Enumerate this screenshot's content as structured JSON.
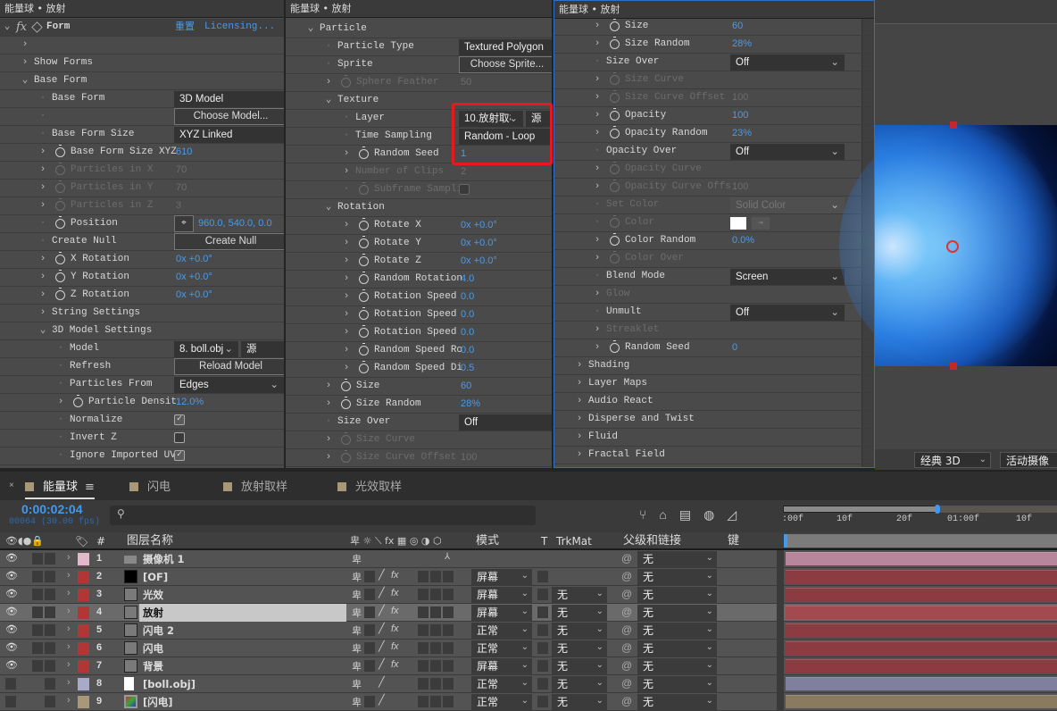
{
  "panel_title": "能量球 • 放射",
  "colors": {
    "accent_blue": "#4a9ae8",
    "highlight_red": "#e8191c",
    "panel_border_blue": "#2f6fd0"
  },
  "effects": {
    "left": {
      "effect_name": "Form",
      "reset": "重置",
      "licensing": "Licensing...",
      "rows": [
        {
          "lvl": 0,
          "tw": "open",
          "label": "Form",
          "special": "header"
        },
        {
          "lvl": 1,
          "tw": "closed",
          "label": ""
        },
        {
          "lvl": 1,
          "tw": "closed",
          "label": "Show Forms"
        },
        {
          "lvl": 1,
          "tw": "open",
          "label": "Base Form"
        },
        {
          "lvl": 2,
          "tw": "none",
          "label": "Base Form",
          "type": "dd",
          "value": "3D Model"
        },
        {
          "lvl": 2,
          "tw": "none",
          "label": "",
          "type": "btn",
          "value": "Choose Model..."
        },
        {
          "lvl": 2,
          "tw": "none",
          "label": "Base Form Size",
          "type": "dd",
          "value": "XYZ Linked"
        },
        {
          "lvl": 2,
          "tw": "closed",
          "sw": true,
          "label": "Base Form Size XYZ",
          "type": "num",
          "value": "610"
        },
        {
          "lvl": 2,
          "tw": "closed",
          "sw": true,
          "dis": true,
          "label": "Particles in X",
          "type": "num",
          "value": "70"
        },
        {
          "lvl": 2,
          "tw": "closed",
          "sw": true,
          "dis": true,
          "label": "Particles in Y",
          "type": "num",
          "value": "70"
        },
        {
          "lvl": 2,
          "tw": "closed",
          "sw": true,
          "dis": true,
          "label": "Particles in Z",
          "type": "num",
          "value": "3"
        },
        {
          "lvl": 2,
          "tw": "none",
          "sw": true,
          "label": "Position",
          "type": "pos",
          "value": "960.0, 540.0, 0.0"
        },
        {
          "lvl": 2,
          "tw": "none",
          "label": "Create Null",
          "type": "btn",
          "value": "Create Null"
        },
        {
          "lvl": 2,
          "tw": "closed",
          "sw": true,
          "label": "X Rotation",
          "type": "num",
          "value": "0x +0.0°"
        },
        {
          "lvl": 2,
          "tw": "closed",
          "sw": true,
          "label": "Y Rotation",
          "type": "num",
          "value": "0x +0.0°"
        },
        {
          "lvl": 2,
          "tw": "closed",
          "sw": true,
          "label": "Z Rotation",
          "type": "num",
          "value": "0x +0.0°"
        },
        {
          "lvl": 2,
          "tw": "closed",
          "label": "String Settings"
        },
        {
          "lvl": 2,
          "tw": "open",
          "label": "3D Model Settings"
        },
        {
          "lvl": 3,
          "tw": "none",
          "label": "Model",
          "type": "layer",
          "value": "8. boll.obj",
          "src": "源"
        },
        {
          "lvl": 3,
          "tw": "none",
          "label": "Refresh",
          "type": "btn",
          "value": "Reload Model"
        },
        {
          "lvl": 3,
          "tw": "none",
          "label": "Particles From",
          "type": "dd",
          "value": "Edges",
          "chev": true
        },
        {
          "lvl": 3,
          "tw": "closed",
          "sw": true,
          "label": "Particle Densit",
          "type": "num",
          "value": "12.0%"
        },
        {
          "lvl": 3,
          "tw": "none",
          "label": "Normalize",
          "type": "cb",
          "checked": true
        },
        {
          "lvl": 3,
          "tw": "none",
          "label": "Invert Z",
          "type": "cb",
          "checked": false
        },
        {
          "lvl": 3,
          "tw": "none",
          "label": "Ignore Imported UVs",
          "type": "cb",
          "checked": true
        }
      ]
    },
    "middle": {
      "rows": [
        {
          "lvl": 1,
          "tw": "open",
          "label": "Particle"
        },
        {
          "lvl": 2,
          "tw": "none",
          "label": "Particle Type",
          "type": "dd",
          "value": "Textured Polygon"
        },
        {
          "lvl": 2,
          "tw": "none",
          "label": "Sprite",
          "type": "btn",
          "value": "Choose Sprite..."
        },
        {
          "lvl": 2,
          "tw": "closed",
          "sw": true,
          "dis": true,
          "label": "Sphere Feather",
          "type": "num",
          "value": "50"
        },
        {
          "lvl": 2,
          "tw": "open",
          "label": "Texture"
        },
        {
          "lvl": 3,
          "tw": "none",
          "label": "Layer",
          "type": "layer",
          "value": "10.放射取样",
          "src": "源"
        },
        {
          "lvl": 3,
          "tw": "none",
          "label": "Time Sampling",
          "type": "dd",
          "value": "Random - Loop"
        },
        {
          "lvl": 3,
          "tw": "closed",
          "sw": true,
          "label": "Random Seed",
          "type": "num",
          "value": "1"
        },
        {
          "lvl": 3,
          "tw": "closed",
          "dis": true,
          "label": "Number of Clips",
          "type": "num",
          "value": "2"
        },
        {
          "lvl": 3,
          "tw": "none",
          "sw": true,
          "dis": true,
          "label": "Subframe Sampli",
          "type": "cb",
          "checked": false
        },
        {
          "lvl": 2,
          "tw": "open",
          "label": "Rotation"
        },
        {
          "lvl": 3,
          "tw": "closed",
          "sw": true,
          "label": "Rotate X",
          "type": "num",
          "value": "0x +0.0°"
        },
        {
          "lvl": 3,
          "tw": "closed",
          "sw": true,
          "label": "Rotate Y",
          "type": "num",
          "value": "0x +0.0°"
        },
        {
          "lvl": 3,
          "tw": "closed",
          "sw": true,
          "label": "Rotate Z",
          "type": "num",
          "value": "0x +0.0°"
        },
        {
          "lvl": 3,
          "tw": "closed",
          "sw": true,
          "label": "Random Rotation",
          "type": "num",
          "value": "4.0"
        },
        {
          "lvl": 3,
          "tw": "closed",
          "sw": true,
          "label": "Rotation Speed",
          "type": "num",
          "value": "0.0"
        },
        {
          "lvl": 3,
          "tw": "closed",
          "sw": true,
          "label": "Rotation Speed",
          "type": "num",
          "value": "0.0"
        },
        {
          "lvl": 3,
          "tw": "closed",
          "sw": true,
          "label": "Rotation Speed",
          "type": "num",
          "value": "0.0"
        },
        {
          "lvl": 3,
          "tw": "closed",
          "sw": true,
          "label": "Random Speed Ro",
          "type": "num",
          "value": "0.0"
        },
        {
          "lvl": 3,
          "tw": "closed",
          "sw": true,
          "label": "Random Speed Di",
          "type": "num",
          "value": "0.5"
        },
        {
          "lvl": 2,
          "tw": "closed",
          "sw": true,
          "label": "Size",
          "type": "num",
          "value": "60"
        },
        {
          "lvl": 2,
          "tw": "closed",
          "sw": true,
          "label": "Size Random",
          "type": "num",
          "value": "28%"
        },
        {
          "lvl": 2,
          "tw": "none",
          "label": "Size Over",
          "type": "dd",
          "value": "Off"
        },
        {
          "lvl": 2,
          "tw": "closed",
          "sw": true,
          "dis": true,
          "label": "Size Curve"
        },
        {
          "lvl": 2,
          "tw": "closed",
          "sw": true,
          "dis": true,
          "label": "Size Curve Offset",
          "type": "num",
          "value": "100"
        }
      ]
    },
    "right": {
      "rows": [
        {
          "lvl": 2,
          "tw": "closed",
          "sw": true,
          "label": "Size",
          "type": "num",
          "value": "60"
        },
        {
          "lvl": 2,
          "tw": "closed",
          "sw": true,
          "label": "Size Random",
          "type": "num",
          "value": "28%"
        },
        {
          "lvl": 2,
          "tw": "none",
          "label": "Size Over",
          "type": "dd",
          "value": "Off",
          "chev": true
        },
        {
          "lvl": 2,
          "tw": "closed",
          "sw": true,
          "dis": true,
          "label": "Size Curve"
        },
        {
          "lvl": 2,
          "tw": "closed",
          "sw": true,
          "dis": true,
          "label": "Size Curve Offset",
          "type": "num",
          "value": "100"
        },
        {
          "lvl": 2,
          "tw": "closed",
          "sw": true,
          "label": "Opacity",
          "type": "num",
          "value": "100"
        },
        {
          "lvl": 2,
          "tw": "closed",
          "sw": true,
          "label": "Opacity Random",
          "type": "num",
          "value": "23%"
        },
        {
          "lvl": 2,
          "tw": "none",
          "label": "Opacity Over",
          "type": "dd",
          "value": "Off",
          "chev": true
        },
        {
          "lvl": 2,
          "tw": "closed",
          "sw": true,
          "dis": true,
          "label": "Opacity Curve"
        },
        {
          "lvl": 2,
          "tw": "closed",
          "sw": true,
          "dis": true,
          "label": "Opacity Curve Offs",
          "type": "num",
          "value": "100"
        },
        {
          "lvl": 2,
          "tw": "none",
          "dis": true,
          "label": "Set Color",
          "type": "dd",
          "value": "Solid Color",
          "chev": true
        },
        {
          "lvl": 2,
          "tw": "none",
          "sw": true,
          "dis": true,
          "label": "Color",
          "type": "color",
          "value": "#ffffff"
        },
        {
          "lvl": 2,
          "tw": "closed",
          "sw": true,
          "label": "Color Random",
          "type": "num",
          "value": "0.0%"
        },
        {
          "lvl": 2,
          "tw": "closed",
          "sw": true,
          "dis": true,
          "label": "Color Over"
        },
        {
          "lvl": 2,
          "tw": "none",
          "label": "Blend Mode",
          "type": "dd",
          "value": "Screen",
          "chev": true
        },
        {
          "lvl": 2,
          "tw": "closed",
          "dis": true,
          "label": "Glow"
        },
        {
          "lvl": 2,
          "tw": "none",
          "label": "Unmult",
          "type": "dd",
          "value": "Off",
          "chev": true
        },
        {
          "lvl": 2,
          "tw": "closed",
          "dis": true,
          "label": "Streaklet"
        },
        {
          "lvl": 2,
          "tw": "closed",
          "sw": true,
          "label": "Random Seed",
          "type": "num",
          "value": "0"
        },
        {
          "lvl": 1,
          "tw": "closed",
          "label": "Shading"
        },
        {
          "lvl": 1,
          "tw": "closed",
          "label": "Layer Maps"
        },
        {
          "lvl": 1,
          "tw": "closed",
          "label": "Audio React"
        },
        {
          "lvl": 1,
          "tw": "closed",
          "label": "Disperse and Twist"
        },
        {
          "lvl": 1,
          "tw": "closed",
          "label": "Fluid"
        },
        {
          "lvl": 1,
          "tw": "closed",
          "label": "Fractal Field"
        }
      ]
    }
  },
  "viewer": {
    "renderer": "经典 3D",
    "camera": "活动摄像"
  },
  "timeline": {
    "tabs": [
      {
        "label": "能量球",
        "active": true
      },
      {
        "label": "闪电"
      },
      {
        "label": "放射取样"
      },
      {
        "label": "光效取样"
      }
    ],
    "timecode": "0:00:02:04",
    "frame_info": "00064 (30.00 fps)",
    "ruler": [
      ":00f",
      "10f",
      "20f",
      "01:00f",
      "10f"
    ],
    "headers": {
      "num": "#",
      "name": "图层名称",
      "mode": "模式",
      "t": "T",
      "trkmat": "TrkMat",
      "parent": "父级和链接",
      "keys": "键"
    },
    "layers": [
      {
        "num": "1",
        "name": "摄像机 1",
        "label_color": "#e3b9c9",
        "src": "camera",
        "mode": "",
        "trkmat": "",
        "parent": "无",
        "bar": "#b8869a",
        "eye": true
      },
      {
        "num": "2",
        "name": "[OF]",
        "label_color": "#b33636",
        "src": "black",
        "mode": "屏幕",
        "trkmat": "",
        "parent": "无",
        "bar": "#8c3c40",
        "eye": true
      },
      {
        "num": "3",
        "name": "光效",
        "label_color": "#b33636",
        "src": "gray",
        "mode": "屏幕",
        "trkmat": "无",
        "parent": "无",
        "bar": "#8c3c40",
        "eye": true
      },
      {
        "num": "4",
        "name": "放射",
        "label_color": "#b33636",
        "src": "gray",
        "mode": "屏幕",
        "trkmat": "无",
        "parent": "无",
        "bar": "#a34a4e",
        "eye": true,
        "selected": true
      },
      {
        "num": "5",
        "name": "闪电 2",
        "label_color": "#b33636",
        "src": "gray",
        "mode": "正常",
        "trkmat": "无",
        "parent": "无",
        "bar": "#8c3c40",
        "eye": true
      },
      {
        "num": "6",
        "name": "闪电",
        "label_color": "#b33636",
        "src": "gray",
        "mode": "正常",
        "trkmat": "无",
        "parent": "无",
        "bar": "#8c3c40",
        "eye": true
      },
      {
        "num": "7",
        "name": "背景",
        "label_color": "#b33636",
        "src": "gray",
        "mode": "屏幕",
        "trkmat": "无",
        "parent": "无",
        "bar": "#8c3c40",
        "eye": true
      },
      {
        "num": "8",
        "name": "[boll.obj]",
        "label_color": "#a9a9c9",
        "src": "file",
        "mode": "正常",
        "trkmat": "无",
        "parent": "无",
        "bar": "#7f7f9e",
        "eye": false
      },
      {
        "num": "9",
        "name": "[闪电]",
        "label_color": "#a89878",
        "src": "comp",
        "mode": "正常",
        "trkmat": "无",
        "parent": "无",
        "bar": "#8a7a60",
        "eye": false
      }
    ]
  }
}
